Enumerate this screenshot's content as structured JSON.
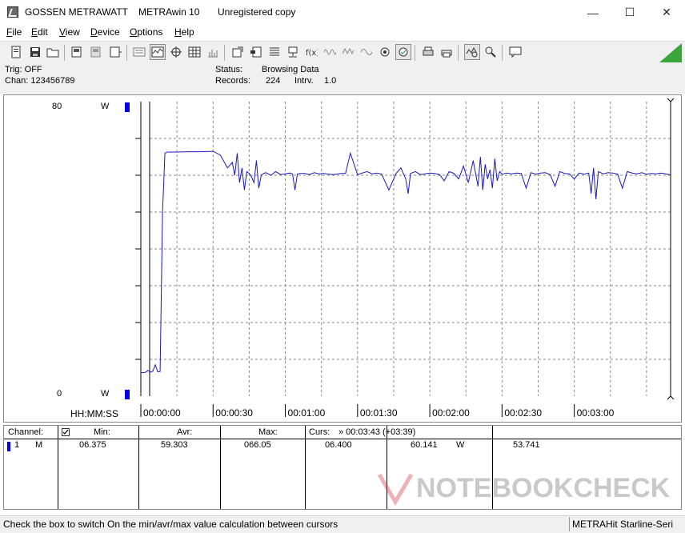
{
  "window": {
    "brand": "GOSSEN METRAWATT",
    "app": "METRAwin 10",
    "license": "Unregistered copy",
    "minimize": "—",
    "maximize": "☐",
    "close": "✕"
  },
  "menu": [
    "File",
    "Edit",
    "View",
    "Device",
    "Options",
    "Help"
  ],
  "menu_mnemonic": [
    "F",
    "E",
    "V",
    "D",
    "O",
    "H"
  ],
  "status": {
    "trig": "Trig: OFF",
    "chan": "Chan:  123456789",
    "status_label": "Status:",
    "status_value": "Browsing Data",
    "records_label": "Records:",
    "records_value": "224",
    "intrv_label": "Intrv.",
    "intrv_value": "1.0"
  },
  "graph": {
    "y_top_value": "80",
    "y_top_unit": "W",
    "y_bottom_value": "0",
    "y_bottom_unit": "W",
    "time_label": "HH:MM:SS",
    "line_color": "#1a1ab4"
  },
  "chart_data": {
    "type": "line",
    "ylim": [
      0,
      80
    ],
    "xlim_seconds": [
      0,
      220
    ],
    "x_ticks": [
      "00:00:00",
      "00:00:30",
      "00:01:00",
      "00:01:30",
      "00:02:00",
      "00:02:30",
      "00:03:00"
    ],
    "series": [
      {
        "unit": "W",
        "x": [
          0,
          1,
          2,
          3,
          4,
          5,
          6,
          7,
          8,
          9,
          10,
          11,
          12,
          15,
          20,
          25,
          30,
          33,
          36,
          38,
          39,
          40,
          41,
          42,
          43,
          44,
          45,
          46,
          47,
          48,
          49,
          50,
          51,
          52,
          54,
          56,
          58,
          60,
          62,
          63,
          64,
          65,
          66,
          68,
          70,
          72,
          74,
          76,
          78,
          80,
          83,
          85,
          87,
          90,
          92,
          94,
          96,
          98,
          100,
          103,
          106,
          108,
          110,
          111,
          112,
          114,
          116,
          118,
          120,
          122,
          124,
          126,
          128,
          130,
          132,
          134,
          136,
          138,
          140,
          141,
          142,
          143,
          144,
          145,
          146,
          147,
          148,
          149,
          150,
          152,
          154,
          156,
          158,
          160,
          162,
          164,
          166,
          168,
          170,
          172,
          174,
          176,
          178,
          180,
          182,
          184,
          186,
          187,
          188,
          189,
          190,
          192,
          194,
          196,
          198,
          200,
          202,
          204,
          206,
          208,
          210,
          212,
          214,
          216,
          218,
          220
        ],
        "y": [
          6.4,
          6.4,
          6.5,
          7,
          6.5,
          6.8,
          8.5,
          6.6,
          6.7,
          50,
          66,
          66.3,
          66.3,
          66.3,
          66.4,
          66.4,
          66.5,
          65.5,
          62,
          63.5,
          60,
          66,
          58,
          62,
          56,
          61,
          60.5,
          59.5,
          58,
          64,
          56.5,
          60,
          60.5,
          60.7,
          60,
          61,
          60.2,
          60.4,
          60.6,
          60.3,
          56,
          60.3,
          60.5,
          60.5,
          60.2,
          60.7,
          60.4,
          60.5,
          60.3,
          60.2,
          60.5,
          60.5,
          66,
          60.2,
          60.6,
          61,
          60.4,
          60.6,
          60.3,
          56,
          60.5,
          62,
          59,
          55,
          60.5,
          61,
          60.2,
          60.4,
          60.6,
          60.5,
          60.2,
          58.5,
          61,
          60.5,
          59,
          62.5,
          58,
          64,
          57,
          65,
          56,
          63,
          59,
          61.5,
          56.5,
          64.5,
          58.5,
          61,
          60.3,
          60.6,
          60.4,
          60.6,
          60.5,
          56.5,
          60.7,
          60.3,
          60.6,
          60.7,
          60.2,
          57,
          61,
          60.5,
          60.4,
          59,
          60.6,
          60.3,
          60.6,
          55,
          62,
          53.5,
          61,
          60.4,
          60.7,
          60.6,
          60.3,
          56.5,
          61,
          60.6,
          60.4,
          60.7,
          60.3,
          60.5,
          60.4,
          60.6,
          60.4,
          60.1
        ]
      }
    ]
  },
  "table": {
    "channel_label": "Channel:",
    "min_label": "Min:",
    "avr_label": "Avr:",
    "max_label": "Max:",
    "curs_label": "Curs:",
    "curs_value": "» 00:03:43 (+03:39)",
    "row": {
      "num": "1",
      "mode": "M",
      "min": "06.375",
      "avr": "59.303",
      "max": "066.05",
      "c1": "06.400",
      "c2": "60.141",
      "c2_unit": "W",
      "c3": "53.741"
    }
  },
  "statusbar": {
    "hint": "Check the box to switch On the min/avr/max value calculation between cursors",
    "device": "METRAHit Starline-Seri"
  },
  "watermark": "NOTEBOOKCHECK"
}
